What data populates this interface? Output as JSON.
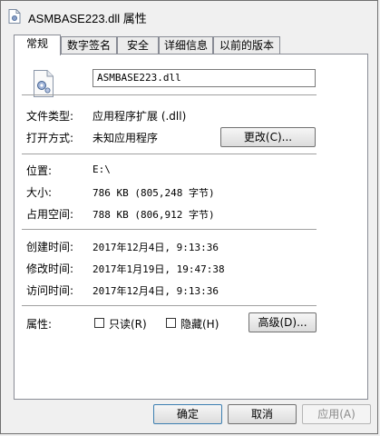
{
  "window": {
    "title": "ASMBASE223.dll 属性"
  },
  "tabs": [
    {
      "label": "常规",
      "active": true
    },
    {
      "label": "数字签名",
      "active": false
    },
    {
      "label": "安全",
      "active": false
    },
    {
      "label": "详细信息",
      "active": false
    },
    {
      "label": "以前的版本",
      "active": false
    }
  ],
  "general": {
    "file_name": "ASMBASE223.dll",
    "file_type_label": "文件类型:",
    "file_type_value": "应用程序扩展 (.dll)",
    "opens_with_label": "打开方式:",
    "opens_with_value": "未知应用程序",
    "change_button": "更改(C)...",
    "location_label": "位置:",
    "location_value": "E:\\",
    "size_label": "大小:",
    "size_value": "786 KB (805,248 字节)",
    "size_on_disk_label": "占用空间:",
    "size_on_disk_value": "788 KB (806,912 字节)",
    "created_label": "创建时间:",
    "created_value": "2017年12月4日, 9:13:36",
    "modified_label": "修改时间:",
    "modified_value": "2017年1月19日, 19:47:38",
    "accessed_label": "访问时间:",
    "accessed_value": "2017年12月4日, 9:13:36",
    "attributes_label": "属性:",
    "readonly_label": "只读(R)",
    "hidden_label": "隐藏(H)",
    "advanced_button": "高级(D)..."
  },
  "footer": {
    "ok_button": "确定",
    "cancel_button": "取消",
    "apply_button": "应用(A)"
  },
  "colors": {
    "window_bg": "#f0f0f0",
    "panel_bg": "#ffffff",
    "border": "#898c95",
    "disabled_text": "#8a8a8a"
  }
}
